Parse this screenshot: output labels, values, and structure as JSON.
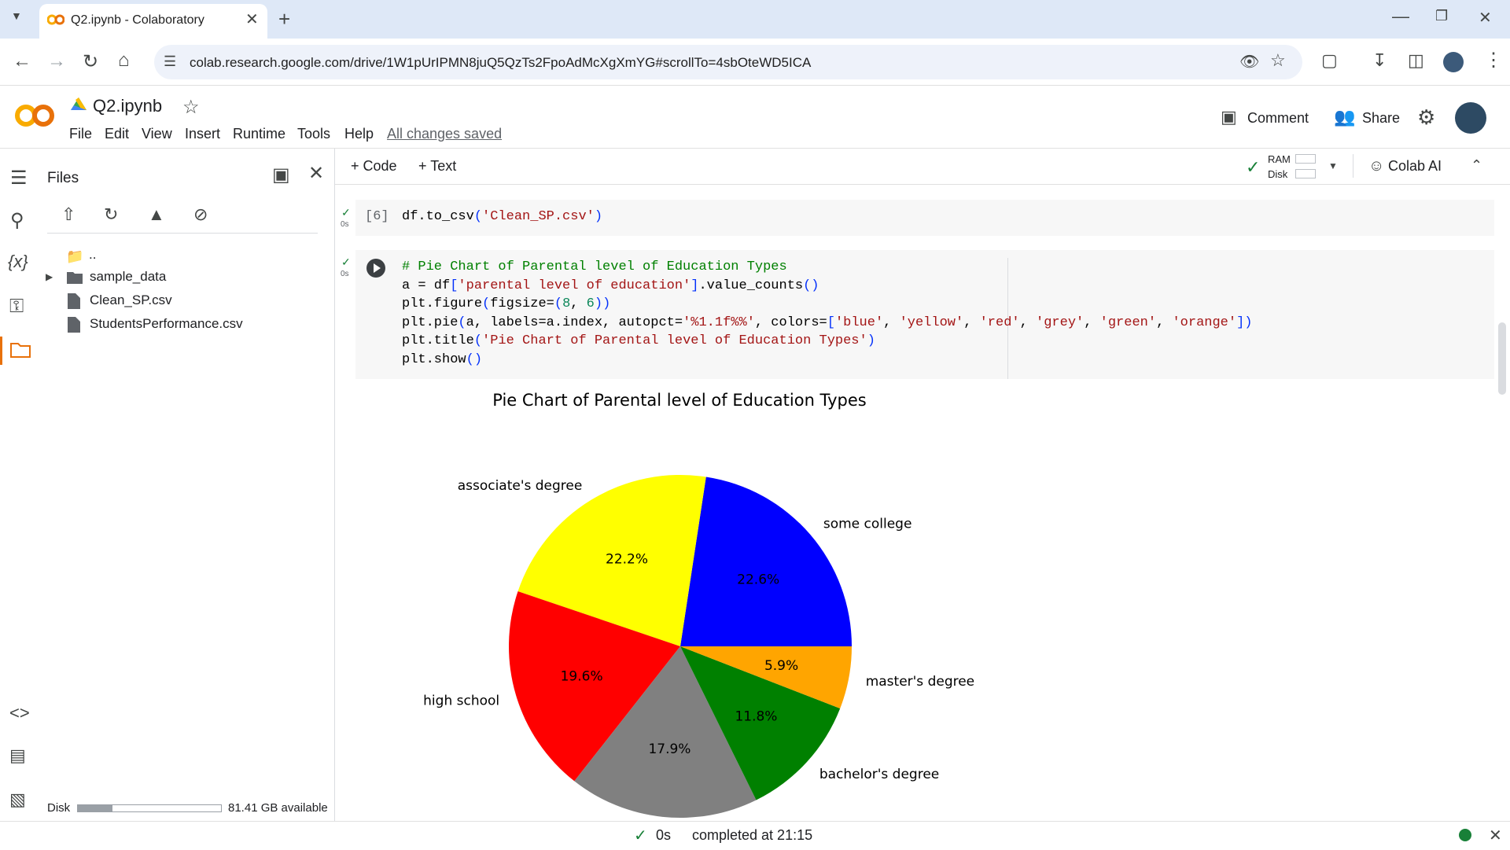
{
  "browser": {
    "tab_title": "Q2.ipynb - Colaboratory",
    "url": "colab.research.google.com/drive/1W1pUrIPMN8juQ5QzTs2FpoAdMcXgXmYG#scrollTo=4sbOteWD5ICA"
  },
  "colab": {
    "notebook_name": "Q2.ipynb",
    "menu": [
      "File",
      "Edit",
      "View",
      "Insert",
      "Runtime",
      "Tools",
      "Help"
    ],
    "saved_status": "All changes saved",
    "comment_label": "Comment",
    "share_label": "Share",
    "add_code_label": "+ Code",
    "add_text_label": "+ Text",
    "ram_label": "RAM",
    "disk_label": "Disk",
    "colab_ai_label": "Colab AI"
  },
  "files_panel": {
    "title": "Files",
    "parent_label": "..",
    "items": [
      "sample_data",
      "Clean_SP.csv",
      "StudentsPerformance.csv"
    ],
    "disk_label": "Disk",
    "disk_available": "81.41 GB available",
    "disk_usage": 0.24
  },
  "cells": {
    "cell6": {
      "exec_count": "[6]",
      "time": "0s"
    },
    "cell7": {
      "time": "0s"
    }
  },
  "status": {
    "elapsed": "0s",
    "completed": "completed at 21:15"
  },
  "chart_data": {
    "type": "pie",
    "title": "Pie Chart of Parental level of Education Types",
    "start_angle_deg": 0,
    "direction": "counterclockwise",
    "slices": [
      {
        "label": "some college",
        "value": 22.6,
        "pct_label": "22.6%",
        "color": "#0000ff"
      },
      {
        "label": "associate's degree",
        "value": 22.2,
        "pct_label": "22.2%",
        "color": "#ffff00"
      },
      {
        "label": "high school",
        "value": 19.6,
        "pct_label": "19.6%",
        "color": "#ff0000"
      },
      {
        "label": "",
        "value": 17.9,
        "pct_label": "17.9%",
        "color": "#808080"
      },
      {
        "label": "bachelor's degree",
        "value": 11.8,
        "pct_label": "11.8%",
        "color": "#008000"
      },
      {
        "label": "master's degree",
        "value": 5.9,
        "pct_label": "5.9%",
        "color": "#ffa500"
      }
    ]
  }
}
